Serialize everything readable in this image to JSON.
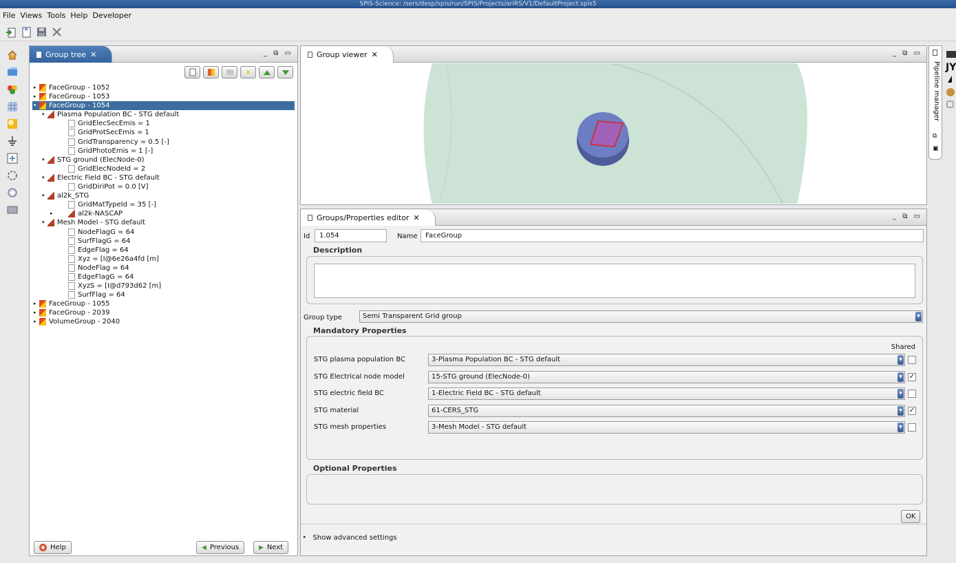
{
  "window": {
    "title": "SPIS-Science: /sers/desp/spis/run/SPIS/Projects/ariRS/V1/DefaultProject.spis5"
  },
  "menu": [
    "File",
    "Views",
    "Tools",
    "Help",
    "Developer"
  ],
  "toolbar": {
    "icons": [
      "import-icon",
      "open-icon",
      "save-icon",
      "close-icon"
    ]
  },
  "left_strip": {
    "icons": [
      "home-icon",
      "geometry-icon",
      "groups-icon",
      "mesh-icon",
      "properties-icon",
      "ground-icon",
      "numerical-icon",
      "solver-icon",
      "analysis-icon",
      "report-icon"
    ]
  },
  "group_tree": {
    "tab": "Group tree",
    "controls": "_ ⧉ ▭",
    "nodes": [
      {
        "label": "FaceGroup - 1052",
        "level": 0,
        "expand": "▸",
        "icon": "fg"
      },
      {
        "label": "FaceGroup - 1053",
        "level": 0,
        "expand": "▸",
        "icon": "fg"
      },
      {
        "label": "FaceGroup - 1054",
        "level": 0,
        "expand": "▾",
        "icon": "fg",
        "selected": true
      },
      {
        "label": "Plasma Population BC - STG default",
        "level": 1,
        "expand": "▾",
        "icon": "bc"
      },
      {
        "label": "GridElecSecEmis = 1",
        "level": 2,
        "expand": "",
        "icon": "doc"
      },
      {
        "label": "GridProtSecEmis = 1",
        "level": 2,
        "expand": "",
        "icon": "doc"
      },
      {
        "label": "GridTransparency = 0.5 [-]",
        "level": 2,
        "expand": "",
        "icon": "doc"
      },
      {
        "label": "GridPhotoEmis = 1 [-]",
        "level": 2,
        "expand": "",
        "icon": "doc"
      },
      {
        "label": "STG ground (ElecNode-0)",
        "level": 1,
        "expand": "▾",
        "icon": "bc"
      },
      {
        "label": "GridElecNodeId = 2",
        "level": 2,
        "expand": "",
        "icon": "doc"
      },
      {
        "label": "Electric Field BC - STG default",
        "level": 1,
        "expand": "▾",
        "icon": "bc"
      },
      {
        "label": "GridDiriPot = 0.0 [V]",
        "level": 2,
        "expand": "",
        "icon": "doc"
      },
      {
        "label": "al2k_STG",
        "level": 1,
        "expand": "▾",
        "icon": "bc"
      },
      {
        "label": "GridMatTypeId = 35 [-]",
        "level": 2,
        "expand": "",
        "icon": "doc"
      },
      {
        "label": "al2k-NASCAP",
        "level": 2,
        "expand": "▸",
        "icon": "bc"
      },
      {
        "label": "Mesh Model - STG default",
        "level": 1,
        "expand": "▾",
        "icon": "bc"
      },
      {
        "label": "NodeFlagG = 64",
        "level": 2,
        "expand": "",
        "icon": "doc"
      },
      {
        "label": "SurfFlagG = 64",
        "level": 2,
        "expand": "",
        "icon": "doc"
      },
      {
        "label": "EdgeFlag = 64",
        "level": 2,
        "expand": "",
        "icon": "doc"
      },
      {
        "label": "Xyz = [I@6e26a4fd [m]",
        "level": 2,
        "expand": "",
        "icon": "doc"
      },
      {
        "label": "NodeFlag = 64",
        "level": 2,
        "expand": "",
        "icon": "doc"
      },
      {
        "label": "EdgeFlagG = 64",
        "level": 2,
        "expand": "",
        "icon": "doc"
      },
      {
        "label": "XyzS = [I@d793d62 [m]",
        "level": 2,
        "expand": "",
        "icon": "doc"
      },
      {
        "label": "SurfFlag = 64",
        "level": 2,
        "expand": "",
        "icon": "doc"
      },
      {
        "label": "FaceGroup - 1055",
        "level": 0,
        "expand": "▸",
        "icon": "fg"
      },
      {
        "label": "FaceGroup - 2039",
        "level": 0,
        "expand": "▸",
        "icon": "fg"
      },
      {
        "label": "VolumeGroup - 2040",
        "level": 0,
        "expand": "▸",
        "icon": "vg"
      }
    ],
    "help_label": "Help",
    "previous_label": "Previous",
    "next_label": "Next"
  },
  "viewer": {
    "tab": "Group viewer",
    "controls": "_ ⧉ ▭"
  },
  "editor": {
    "tab": "Groups/Properties editor",
    "controls": "_ ⧉ ▭",
    "id_label": "Id",
    "id_value": "1.054",
    "name_label": "Name",
    "name_value": "FaceGroup",
    "description_label": "Description",
    "description_value": "",
    "group_type_label": "Group type",
    "group_type_value": "Semi Transparent Grid group",
    "mandatory_label": "Mandatory Properties",
    "shared_label": "Shared",
    "properties": [
      {
        "label": "STG plasma population BC",
        "value": "3-Plasma Population BC - STG default",
        "shared": false
      },
      {
        "label": "STG Electrical node model",
        "value": "15-STG ground (ElecNode-0)",
        "shared": true
      },
      {
        "label": "STG electric field BC",
        "value": "1-Electric Field BC - STG default",
        "shared": false
      },
      {
        "label": "STG material",
        "value": "61-CERS_STG",
        "shared": true
      },
      {
        "label": "STG mesh properties",
        "value": "3-Mesh Model - STG default",
        "shared": false
      }
    ],
    "optional_label": "Optional Properties",
    "ok_label": "OK",
    "advanced_label": "Show advanced settings"
  },
  "pipeline": {
    "label": "Pipeline manager"
  },
  "far_right": {
    "text": "JY"
  }
}
